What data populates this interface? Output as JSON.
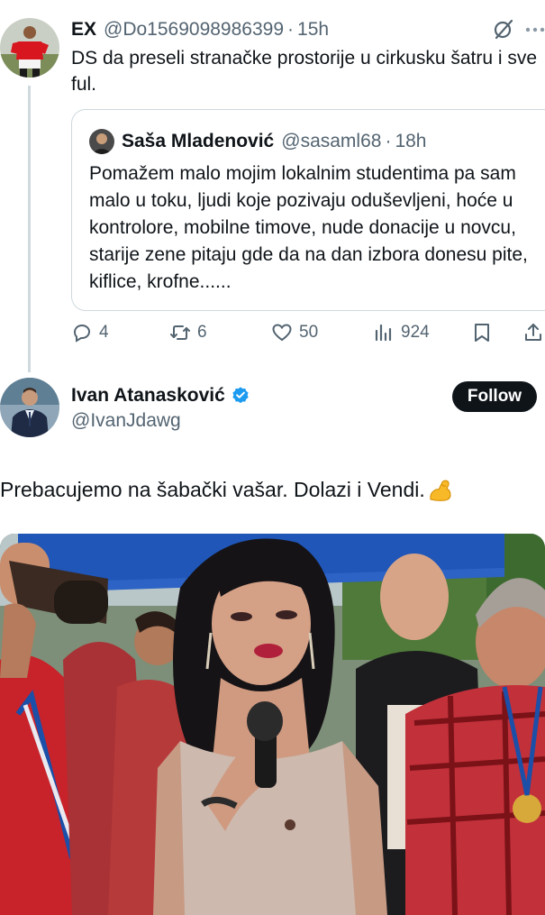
{
  "reply": {
    "name": "EX",
    "handle": "@Do1569098986399",
    "dot": "·",
    "time": "15h",
    "text": "DS da preseli stranačke prostorije u cirkusku šatru i sve ful.",
    "quote": {
      "name": "Saša Mladenović",
      "handle": "@sasaml68",
      "dot": "·",
      "time": "18h",
      "text": "Pomažem malo mojim lokalnim studentima pa sam malo u toku, ljudi koje pozivaju oduševljeni, hoće u kontrolore, mobilne timove, nude donacije u novcu, starije zene pitaju gde da na dan izbora donesu pite, kiflice, krofne......"
    },
    "actions": {
      "replies": "4",
      "reposts": "6",
      "likes": "50",
      "views": "924"
    }
  },
  "main": {
    "name": "Ivan Atanasković",
    "handle": "@IvanJdawg",
    "follow_label": "Follow",
    "text": "Prebacujemo na šabački vašar. Dolazi i Vendi.",
    "emoji": "flexed-biceps"
  },
  "colors": {
    "text": "#0f1419",
    "secondary": "#536471",
    "border": "#cfd9de",
    "verified": "#1d9bf0",
    "follow_bg": "#0f1419"
  },
  "icons": [
    "grok-icon",
    "more-icon",
    "reply-icon",
    "repost-icon",
    "like-icon",
    "views-icon",
    "bookmark-icon",
    "share-icon",
    "verified-badge-icon"
  ]
}
